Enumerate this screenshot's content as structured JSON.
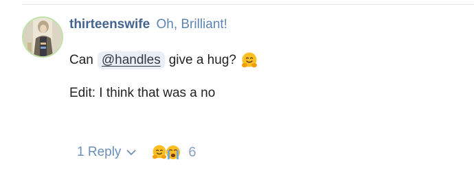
{
  "post": {
    "author": {
      "username": "thirteenswife",
      "title": "Oh, Brilliant!",
      "avatar_icon": "avatar-image"
    },
    "body": {
      "line1_before": "Can",
      "mention": "@handles",
      "line1_after": "give a hug?",
      "line1_emoji": "hugging-face-emoji",
      "line2": "Edit: I think that was a no"
    },
    "footer": {
      "replies_label": "1 Reply",
      "replies_icon": "chevron-down-icon",
      "reactions": [
        "hugging-face-emoji",
        "crying-face-emoji"
      ],
      "reaction_count": "6"
    }
  },
  "colors": {
    "username": "#44648f",
    "title": "#5b84b3",
    "mention_bg": "#eaeff5",
    "link": "#6b8fb8",
    "count": "#8aa3c2",
    "emoji_yellow": "#fbbf24",
    "avatar_border": "#bfe0a8"
  }
}
